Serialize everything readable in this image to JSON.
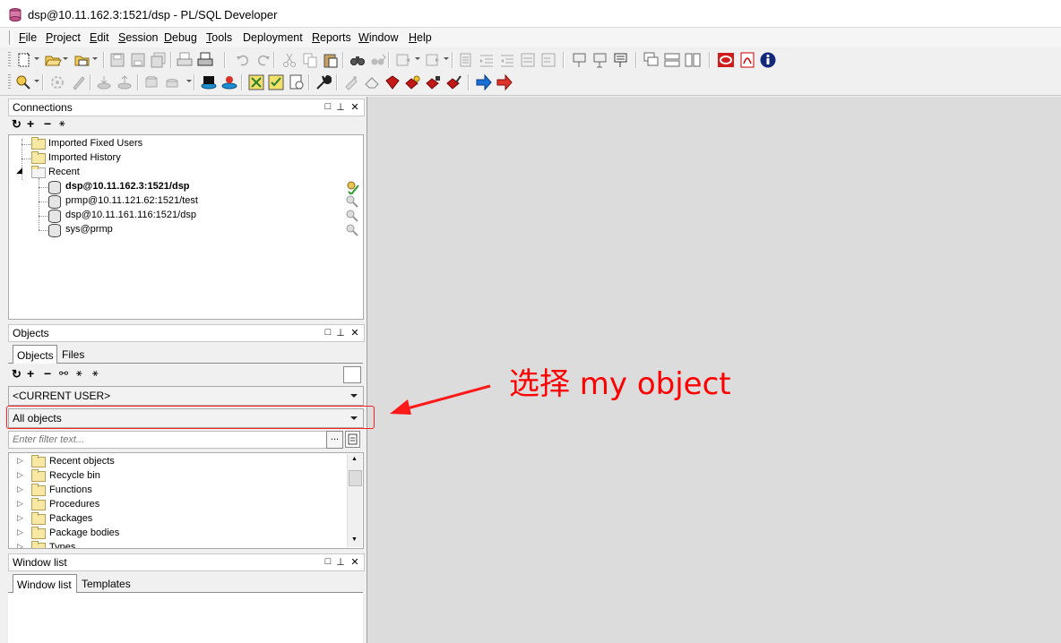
{
  "window": {
    "title": "dsp@10.11.162.3:1521/dsp - PL/SQL Developer"
  },
  "menu": [
    {
      "label": "File",
      "u": "F",
      "rest": "ile"
    },
    {
      "label": "Project",
      "u": "P",
      "rest": "roject"
    },
    {
      "label": "Edit",
      "u": "E",
      "rest": "dit"
    },
    {
      "label": "Session",
      "u": "S",
      "rest": "ession"
    },
    {
      "label": "Debug",
      "u": "D",
      "rest": "ebug"
    },
    {
      "label": "Tools",
      "u": "T",
      "rest": "ools"
    },
    {
      "label": "Deployment",
      "u": "",
      "rest": "Deployment"
    },
    {
      "label": "Reports",
      "u": "R",
      "rest": "eports"
    },
    {
      "label": "Window",
      "u": "W",
      "rest": "indow"
    },
    {
      "label": "Help",
      "u": "H",
      "rest": "elp"
    }
  ],
  "connections": {
    "title": "Connections",
    "items": [
      {
        "label": "Imported Fixed Users"
      },
      {
        "label": "Imported History"
      },
      {
        "label": "Recent"
      },
      {
        "label": "dsp@10.11.162.3:1521/dsp"
      },
      {
        "label": "prmp@10.11.121.62:1521/test"
      },
      {
        "label": "dsp@10.11.161.116:1521/dsp"
      },
      {
        "label": "sys@prmp"
      }
    ]
  },
  "objects": {
    "title": "Objects",
    "tabs": [
      "Objects",
      "Files"
    ],
    "user_combo": "<CURRENT USER>",
    "filter_combo": "All objects",
    "filter_placeholder": "Enter filter text...",
    "ellipsis": "...",
    "tree": [
      "Recent objects",
      "Recycle bin",
      "Functions",
      "Procedures",
      "Packages",
      "Package bodies",
      "Types"
    ]
  },
  "window_list": {
    "title": "Window list",
    "tabs": [
      "Window list",
      "Templates"
    ]
  },
  "annotation": {
    "text": "选择 my object",
    "color": "#ff0000"
  }
}
